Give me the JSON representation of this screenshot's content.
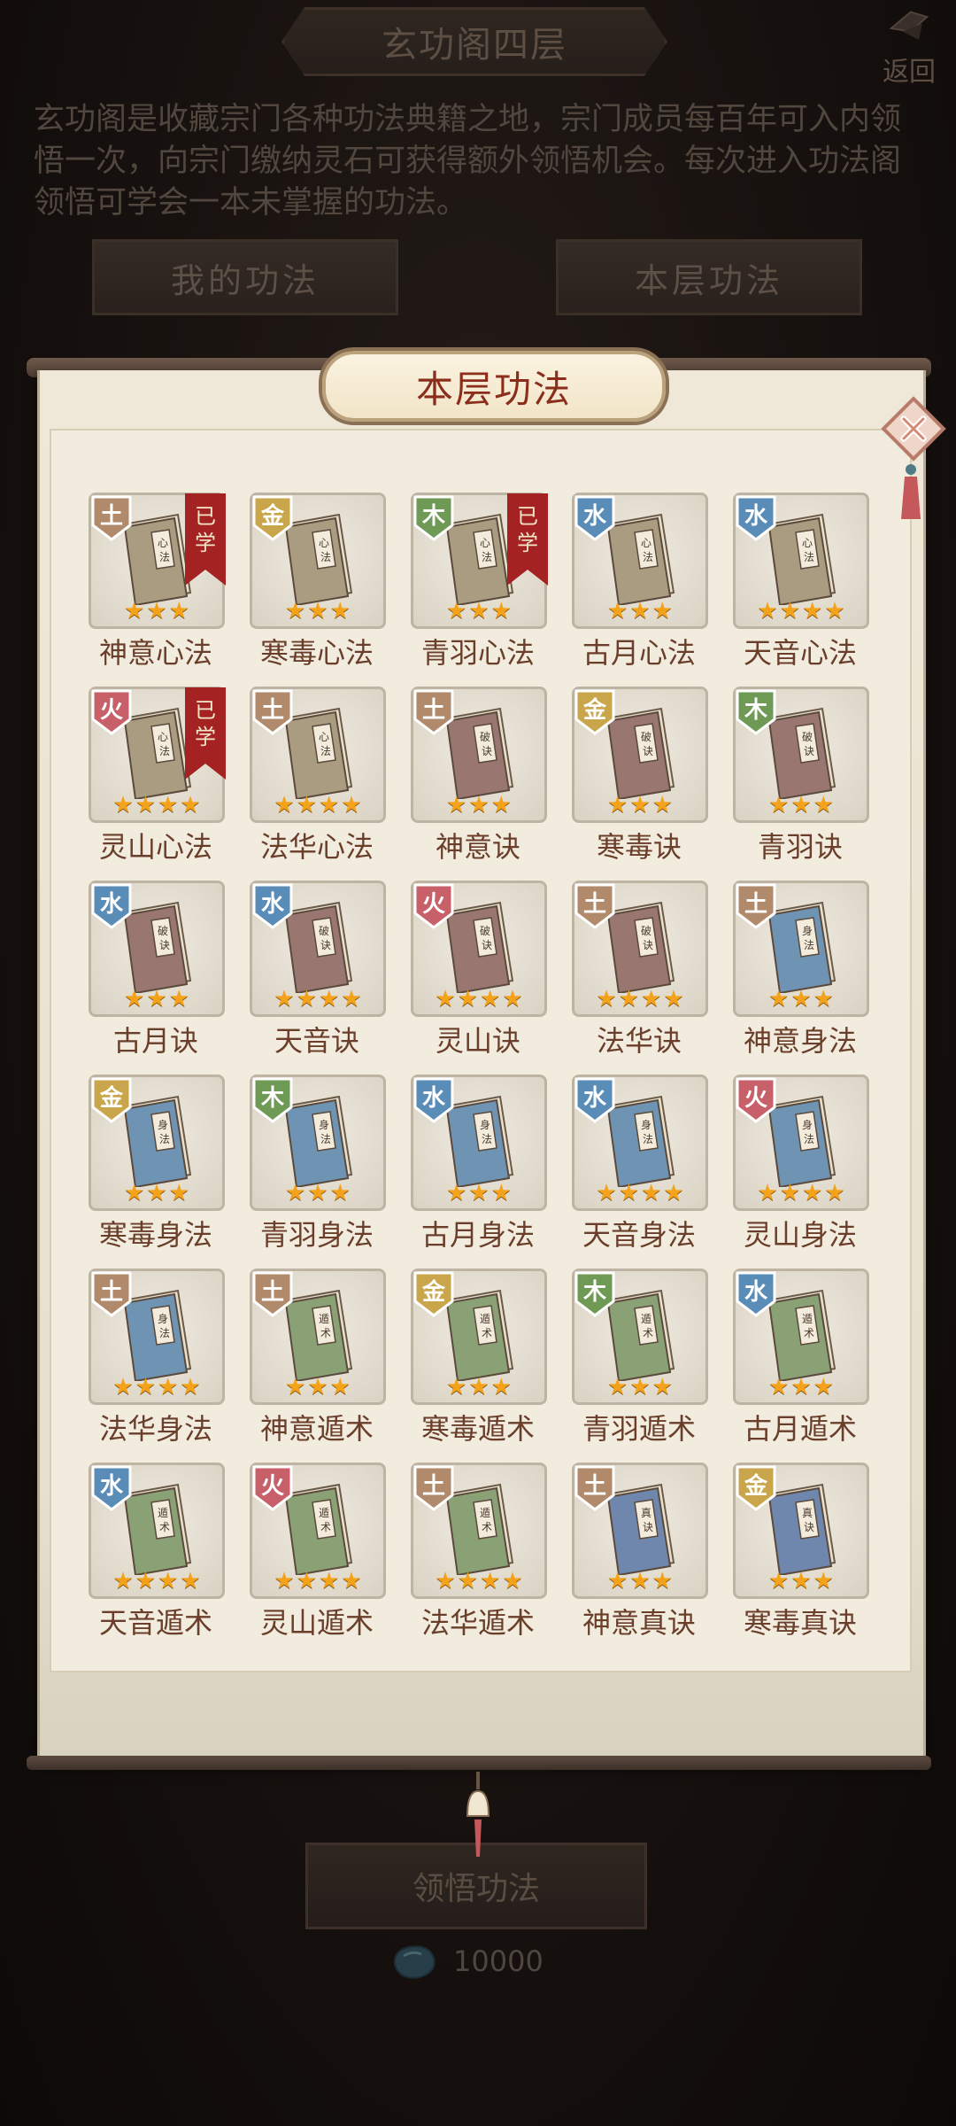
{
  "header": {
    "title": "玄功阁四层",
    "back_label": "返回",
    "description": "玄功阁是收藏宗门各种功法典籍之地，宗门成员每百年可入内领悟一次，向宗门缴纳灵石可获得额外领悟机会。每次进入功法阁领悟可学会一本未掌握的功法。",
    "tabs": [
      "我的功法",
      "本层功法"
    ]
  },
  "panel": {
    "title": "本层功法",
    "learned_badge": "已学",
    "books": [
      {
        "name": "神意心法",
        "element": "土",
        "stars": 3,
        "learned": true,
        "type": "xin"
      },
      {
        "name": "寒毒心法",
        "element": "金",
        "stars": 3,
        "learned": false,
        "type": "xin"
      },
      {
        "name": "青羽心法",
        "element": "木",
        "stars": 3,
        "learned": true,
        "type": "xin"
      },
      {
        "name": "古月心法",
        "element": "水",
        "stars": 3,
        "learned": false,
        "type": "xin"
      },
      {
        "name": "天音心法",
        "element": "水",
        "stars": 4,
        "learned": false,
        "type": "xin"
      },
      {
        "name": "灵山心法",
        "element": "火",
        "stars": 4,
        "learned": true,
        "type": "xin"
      },
      {
        "name": "法华心法",
        "element": "土",
        "stars": 4,
        "learned": false,
        "type": "xin"
      },
      {
        "name": "神意诀",
        "element": "土",
        "stars": 3,
        "learned": false,
        "type": "jue"
      },
      {
        "name": "寒毒诀",
        "element": "金",
        "stars": 3,
        "learned": false,
        "type": "jue"
      },
      {
        "name": "青羽诀",
        "element": "木",
        "stars": 3,
        "learned": false,
        "type": "jue"
      },
      {
        "name": "古月诀",
        "element": "水",
        "stars": 3,
        "learned": false,
        "type": "jue"
      },
      {
        "name": "天音诀",
        "element": "水",
        "stars": 4,
        "learned": false,
        "type": "jue"
      },
      {
        "name": "灵山诀",
        "element": "火",
        "stars": 4,
        "learned": false,
        "type": "jue"
      },
      {
        "name": "法华诀",
        "element": "土",
        "stars": 4,
        "learned": false,
        "type": "jue"
      },
      {
        "name": "神意身法",
        "element": "土",
        "stars": 3,
        "learned": false,
        "type": "shen"
      },
      {
        "name": "寒毒身法",
        "element": "金",
        "stars": 3,
        "learned": false,
        "type": "shen"
      },
      {
        "name": "青羽身法",
        "element": "木",
        "stars": 3,
        "learned": false,
        "type": "shen"
      },
      {
        "name": "古月身法",
        "element": "水",
        "stars": 3,
        "learned": false,
        "type": "shen"
      },
      {
        "name": "天音身法",
        "element": "水",
        "stars": 4,
        "learned": false,
        "type": "shen"
      },
      {
        "name": "灵山身法",
        "element": "火",
        "stars": 4,
        "learned": false,
        "type": "shen"
      },
      {
        "name": "法华身法",
        "element": "土",
        "stars": 4,
        "learned": false,
        "type": "shen"
      },
      {
        "name": "神意遁术",
        "element": "土",
        "stars": 3,
        "learned": false,
        "type": "dun"
      },
      {
        "name": "寒毒遁术",
        "element": "金",
        "stars": 3,
        "learned": false,
        "type": "dun"
      },
      {
        "name": "青羽遁术",
        "element": "木",
        "stars": 3,
        "learned": false,
        "type": "dun"
      },
      {
        "name": "古月遁术",
        "element": "水",
        "stars": 3,
        "learned": false,
        "type": "dun"
      },
      {
        "name": "天音遁术",
        "element": "水",
        "stars": 4,
        "learned": false,
        "type": "dun"
      },
      {
        "name": "灵山遁术",
        "element": "火",
        "stars": 4,
        "learned": false,
        "type": "dun"
      },
      {
        "name": "法华遁术",
        "element": "土",
        "stars": 4,
        "learned": false,
        "type": "dun"
      },
      {
        "name": "神意真诀",
        "element": "土",
        "stars": 3,
        "learned": false,
        "type": "zhen"
      },
      {
        "name": "寒毒真诀",
        "element": "金",
        "stars": 3,
        "learned": false,
        "type": "zhen"
      }
    ]
  },
  "footer": {
    "learn_button": "领悟功法",
    "cost": "10000",
    "cost_icon": "spirit-stone-icon"
  },
  "colors": {
    "element_土": "#b08a6a",
    "element_金": "#c9a64b",
    "element_木": "#6f9a55",
    "element_水": "#5a8cb8",
    "element_火": "#c8606a",
    "book_xin": "#a99c80",
    "book_jue": "#9a7671",
    "book_shen": "#6f94b3",
    "book_dun": "#8aa075",
    "book_zhen": "#6f86ad",
    "star": "#f3a21a",
    "learned_ribbon": "#a42222"
  }
}
